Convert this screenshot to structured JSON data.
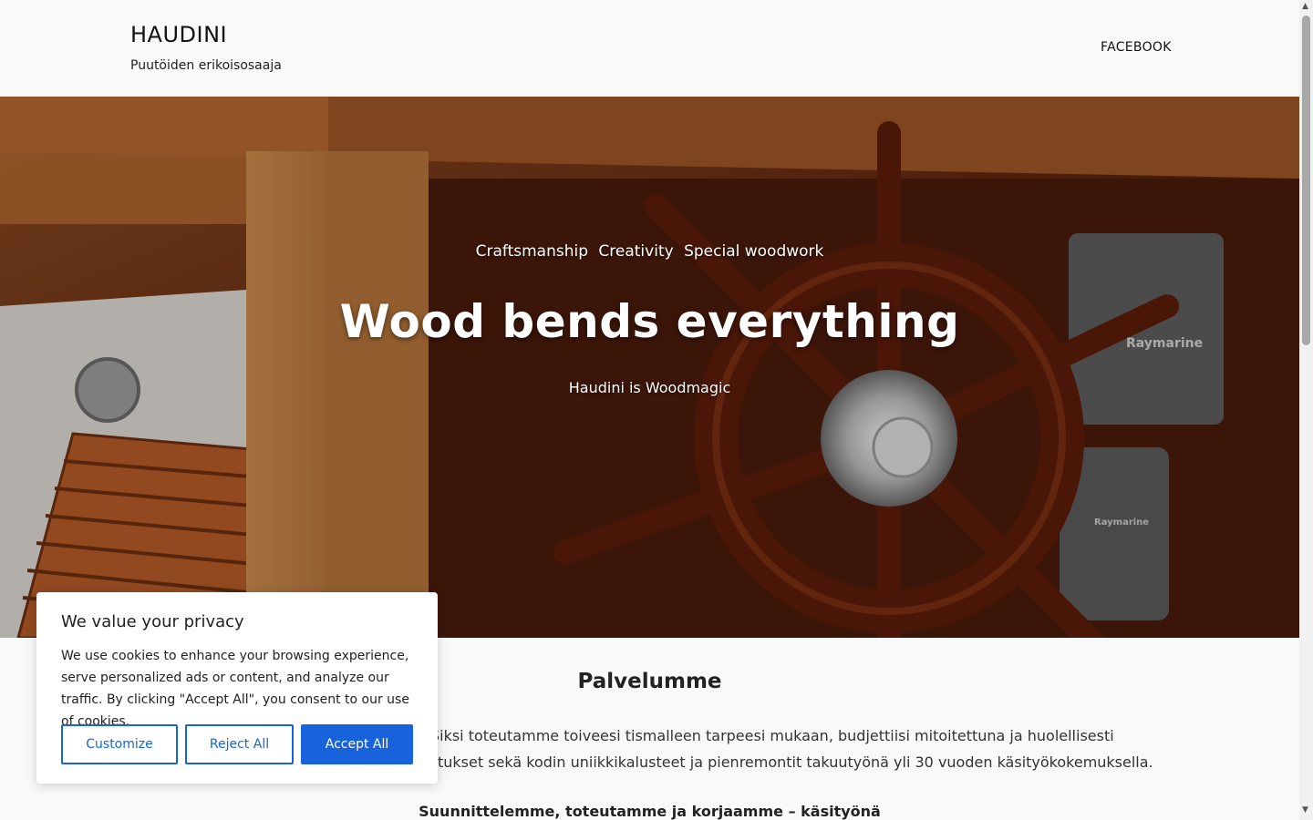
{
  "header": {
    "site_title": "HAUDINI",
    "tagline": "Puutöiden erikoisosaaja",
    "nav": {
      "facebook": "FACEBOOK"
    }
  },
  "hero": {
    "eyebrow": [
      "Craftsmanship",
      "Creativity",
      "Special woodwork"
    ],
    "title": "Wood bends everything",
    "subtitle": "Haudini is Woodmagic",
    "image_text": {
      "brand_a": "Raymarine",
      "brand_b": "Raymarine"
    }
  },
  "content": {
    "section_title": "Palvelumme",
    "line1": "a. Siksi toteutamme toiveesi tismalleen tarpeesi mukaan, budjettiisi mitoitettuna ja huolellisesti",
    "line2": "tukset sekä kodin uniikkikalusteet ja pienremontit takuutyönä yli 30 vuoden käsityökokemuksella.",
    "subhead": "Suunnittelemme, toteutamme ja korjaamme – käsityönä"
  },
  "cookie": {
    "title": "We value your privacy",
    "text": "We use cookies to enhance your browsing experience, serve personalized ads or content, and analyze our traffic. By clicking \"Accept All\", you consent to our use of cookies.",
    "customize": "Customize",
    "reject": "Reject All",
    "accept": "Accept All"
  },
  "colors": {
    "accent": "#1863dc",
    "page_bg": "#f9f9f9"
  }
}
